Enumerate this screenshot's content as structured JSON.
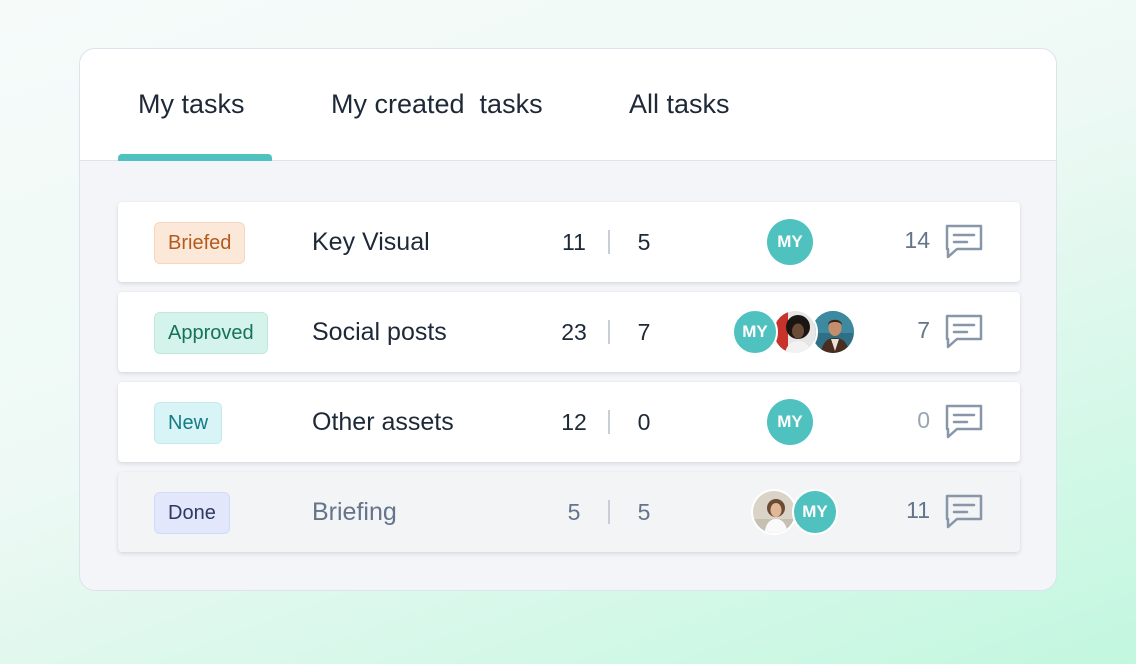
{
  "tabs": [
    {
      "label": "My tasks",
      "active": true
    },
    {
      "label": "My created  tasks",
      "active": false
    },
    {
      "label": "All tasks",
      "active": false
    }
  ],
  "colors": {
    "accent": "#4fc1bf",
    "text": "#1e2938",
    "muted": "#64748b"
  },
  "tasks": [
    {
      "status": "Briefed",
      "status_bg": "#fce8d8",
      "status_color": "#b45a1e",
      "title": "Key Visual",
      "count_a": "11",
      "count_b": "5",
      "avatars": [
        "MY"
      ],
      "comments": "14",
      "done": false
    },
    {
      "status": "Approved",
      "status_bg": "#d4f3ea",
      "status_color": "#16725a",
      "title": "Social posts",
      "count_a": "23",
      "count_b": "7",
      "avatars": [
        "MY",
        "photo-woman-curly-hair",
        "photo-man"
      ],
      "comments": "7",
      "done": false
    },
    {
      "status": "New",
      "status_bg": "#d8f4f7",
      "status_color": "#137c87",
      "title": "Other assets",
      "count_a": "12",
      "count_b": "0",
      "avatars": [
        "MY"
      ],
      "comments": "0",
      "done": false
    },
    {
      "status": "Done",
      "status_bg": "#e2e7fc",
      "status_color": "#2c3a5e",
      "title": "Briefing",
      "count_a": "5",
      "count_b": "5",
      "avatars": [
        "photo-woman-white-shirt",
        "MY"
      ],
      "comments": "11",
      "done": true
    }
  ],
  "icons": {
    "comment": "comment-icon"
  }
}
